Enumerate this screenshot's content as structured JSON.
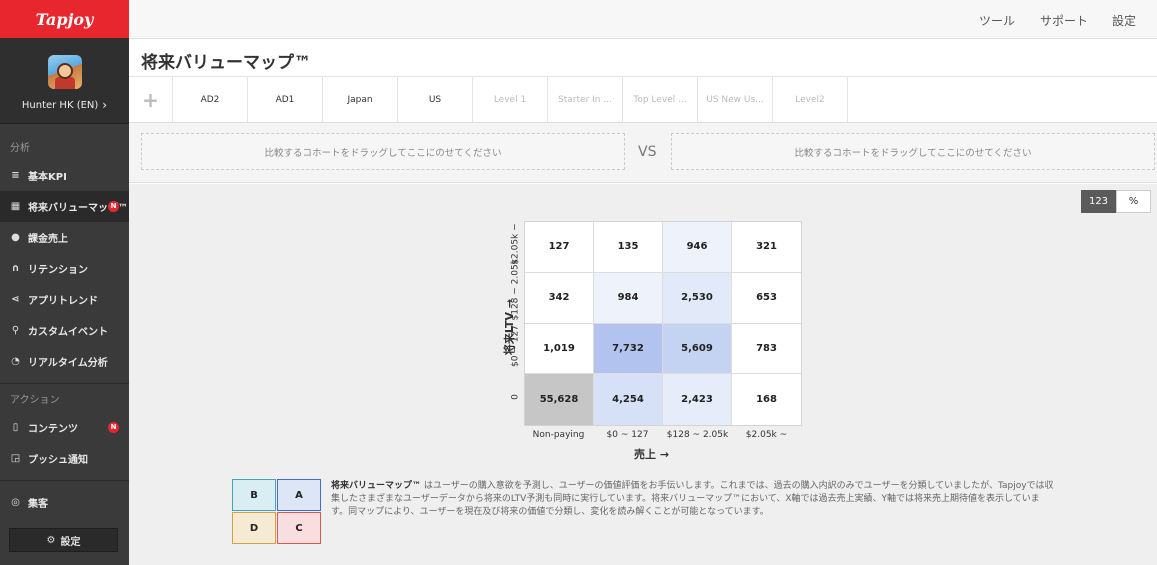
{
  "brand": {
    "logo": "Tapjoy",
    "accent": "#e8262d"
  },
  "app": {
    "name": "Hunter HK (EN)"
  },
  "sidebar": {
    "analysis_label": "分析",
    "analysis_items": [
      {
        "label": "基本KPI",
        "icon": "list-icon"
      },
      {
        "label": "将来バリューマップ™",
        "icon": "grid-icon",
        "active": true,
        "badge": "N"
      },
      {
        "label": "課金売上",
        "icon": "coin-icon"
      },
      {
        "label": "リテンション",
        "icon": "magnet-icon"
      },
      {
        "label": "アプリトレンド",
        "icon": "share-icon"
      },
      {
        "label": "カスタムイベント",
        "icon": "search-icon"
      },
      {
        "label": "リアルタイム分析",
        "icon": "clock-icon"
      }
    ],
    "action_label": "アクション",
    "action_items": [
      {
        "label": "コンテンツ",
        "icon": "bookmark-icon",
        "badge": "N"
      },
      {
        "label": "プッシュ通知",
        "icon": "push-icon"
      }
    ],
    "collect_item": {
      "label": "集客",
      "icon": "target-icon"
    },
    "settings_button": "設定"
  },
  "topnav": {
    "tools": "ツール",
    "support": "サポート",
    "settings": "設定"
  },
  "page": {
    "title": "将来バリューマップ™"
  },
  "cohort_tabs": [
    "AD2",
    "AD1",
    "Japan",
    "US",
    "Level 1",
    "Starter In ...",
    "Top Level ...",
    "US New Us...",
    "Level2"
  ],
  "compare": {
    "left_placeholder": "比較するコホートをドラッグしてここにのせてください",
    "vs": "VS",
    "right_placeholder": "比較するコホートをドラッグしてここにのせてください"
  },
  "view_toggle": {
    "count": "123",
    "percent": "%"
  },
  "chart_data": {
    "type": "heatmap",
    "x_title": "売上 →",
    "y_title": "将来LTV →",
    "x_categories": [
      "Non-paying",
      "$0 ~ 127",
      "$128 ~ 2.05k",
      "$2.05k ~"
    ],
    "y_categories_top_to_bottom": [
      "$2.05k ~",
      "$128 ~ 2.05k",
      "$0 ~ 127",
      "0"
    ],
    "values_top_to_bottom": [
      [
        "127",
        "135",
        "946",
        "321"
      ],
      [
        "342",
        "984",
        "2,530",
        "653"
      ],
      [
        "1,019",
        "7,732",
        "5,609",
        "783"
      ],
      [
        "55,628",
        "4,254",
        "2,423",
        "168"
      ]
    ],
    "cell_colors_top_to_bottom": [
      [
        "#ffffff",
        "#ffffff",
        "#eef2fb",
        "#ffffff"
      ],
      [
        "#ffffff",
        "#eef2fb",
        "#e2e9f8",
        "#ffffff"
      ],
      [
        "#ffffff",
        "#b1c3ee",
        "#c5d3f2",
        "#ffffff"
      ],
      [
        "#c6c6c6",
        "#d6e0f6",
        "#e6ecf9",
        "#ffffff"
      ]
    ]
  },
  "legend": {
    "quadrants": [
      {
        "label": "B",
        "color": "#4aa3b5",
        "bg": "#d9eef2"
      },
      {
        "label": "A",
        "color": "#3f6fc9",
        "bg": "#dde6f7"
      },
      {
        "label": "D",
        "color": "#d2a24a",
        "bg": "#f6ead3"
      },
      {
        "label": "C",
        "color": "#e0574f",
        "bg": "#f8dede"
      }
    ]
  },
  "description": {
    "title": "将来バリューマップ™",
    "text": " はユーザーの購入意欲を予測し、ユーザーの価値評価をお手伝いします。これまでは、過去の購入内訳のみでユーザーを分類していましたが、Tapjoyでは収集したさまざまなユーザーデータから将来のLTV予測も同時に実行しています。将来バリューマップ™において、X軸では過去売上実績、Y軸では将来売上期待値を表示しています。同マップにより、ユーザーを現在及び将来の価値で分類し、変化を読み解くことが可能となっています。"
  }
}
